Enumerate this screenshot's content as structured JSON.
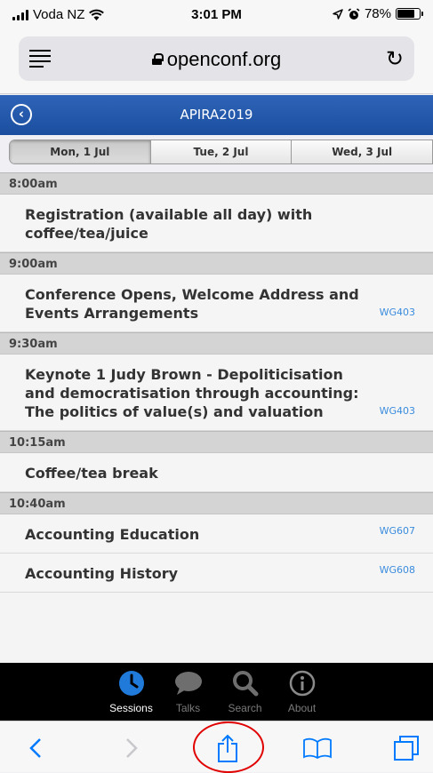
{
  "status_bar": {
    "carrier": "Voda NZ",
    "time": "3:01 PM",
    "battery": "78%",
    "battery_level": 0.78
  },
  "browser": {
    "url": "openconf.org"
  },
  "app": {
    "title": "APIRA2019"
  },
  "day_tabs": [
    {
      "label": "Mon, 1 Jul",
      "active": true
    },
    {
      "label": "Tue, 2 Jul",
      "active": false
    },
    {
      "label": "Wed, 3 Jul",
      "active": false
    }
  ],
  "schedule": {
    "slots": [
      {
        "time": "8:00am",
        "sessions": [
          {
            "title": "Registration (available all day) with coffee/tea/juice",
            "room": ""
          }
        ]
      },
      {
        "time": "9:00am",
        "sessions": [
          {
            "title": "Conference Opens, Welcome Address and Events Arrangements",
            "room": "WG403"
          }
        ]
      },
      {
        "time": "9:30am",
        "sessions": [
          {
            "title": "Keynote 1 Judy Brown - Depoliticisation and democratisation through accounting: The politics of value(s) and valuation",
            "room": "WG403"
          }
        ]
      },
      {
        "time": "10:15am",
        "sessions": [
          {
            "title": "Coffee/tea break",
            "room": ""
          }
        ]
      },
      {
        "time": "10:40am",
        "sessions": [
          {
            "title": "Accounting Education",
            "room": "WG607"
          },
          {
            "title": "Accounting History",
            "room": "WG608"
          }
        ]
      }
    ]
  },
  "app_tabs": [
    {
      "label": "Sessions",
      "icon": "clock-icon",
      "active": true
    },
    {
      "label": "Talks",
      "icon": "speech-bubble-icon",
      "active": false
    },
    {
      "label": "Search",
      "icon": "magnifier-icon",
      "active": false
    },
    {
      "label": "About",
      "icon": "info-icon",
      "active": false
    }
  ],
  "toolbar": {
    "icons": [
      "back-icon",
      "forward-icon",
      "share-icon",
      "bookmarks-icon",
      "tabs-icon"
    ]
  },
  "colors": {
    "header_blue": "#1b4e9f",
    "room_link": "#3a8cdd",
    "ios_blue": "#007aff",
    "highlight_circle": "#e00000"
  }
}
